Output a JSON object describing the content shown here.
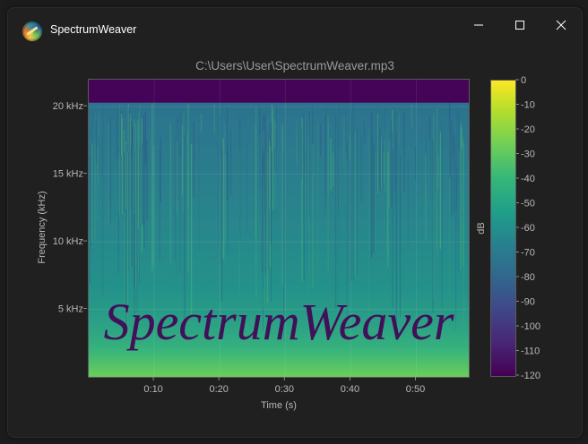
{
  "window": {
    "title": "SpectrumWeaver",
    "icon": "spectrum-weaver-logo-icon",
    "controls": [
      "minimize-icon",
      "maximize-icon",
      "close-icon"
    ]
  },
  "plot": {
    "title": "C:\\Users\\User\\SpectrumWeaver.mp3",
    "watermark_text": "SpectrumWeaver"
  },
  "chart_data": {
    "type": "heatmap",
    "title": "C:\\Users\\User\\SpectrumWeaver.mp3",
    "xlabel": "Time (s)",
    "ylabel": "Frequency (kHz)",
    "colorbar_label": "dB",
    "x_ticks": [
      {
        "value": 10,
        "label": "0:10"
      },
      {
        "value": 20,
        "label": "0:20"
      },
      {
        "value": 30,
        "label": "0:30"
      },
      {
        "value": 40,
        "label": "0:40"
      },
      {
        "value": 50,
        "label": "0:50"
      }
    ],
    "y_ticks": [
      {
        "value": 5,
        "label": "5 kHz"
      },
      {
        "value": 10,
        "label": "10 kHz"
      },
      {
        "value": 15,
        "label": "15 kHz"
      },
      {
        "value": 20,
        "label": "20 kHz"
      }
    ],
    "colorbar_ticks": [
      0,
      -10,
      -20,
      -30,
      -40,
      -50,
      -60,
      -70,
      -80,
      -90,
      -100,
      -110,
      -120
    ],
    "xlim": [
      0,
      58
    ],
    "ylim": [
      0,
      22
    ],
    "clim": [
      -120,
      0
    ],
    "colormap": "viridis",
    "lowpass_cutoff_khz": 20.3,
    "grid": true
  }
}
